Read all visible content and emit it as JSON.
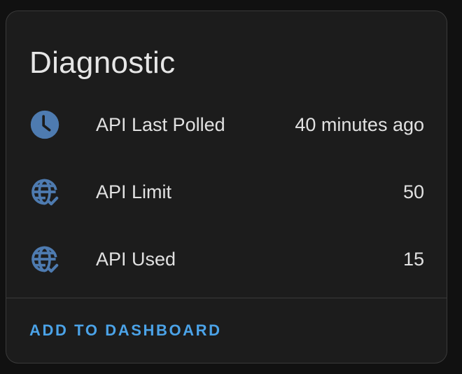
{
  "card": {
    "title": "Diagnostic",
    "icon_color": "#4e7bb0",
    "entities": [
      {
        "icon": "clock-icon",
        "name": "API Last Polled",
        "state": "40 minutes ago"
      },
      {
        "icon": "web-check-icon",
        "name": "API Limit",
        "state": "50"
      },
      {
        "icon": "web-check-icon",
        "name": "API Used",
        "state": "15"
      }
    ],
    "action_label": "ADD TO DASHBOARD",
    "action_color": "#4ba3e8"
  }
}
